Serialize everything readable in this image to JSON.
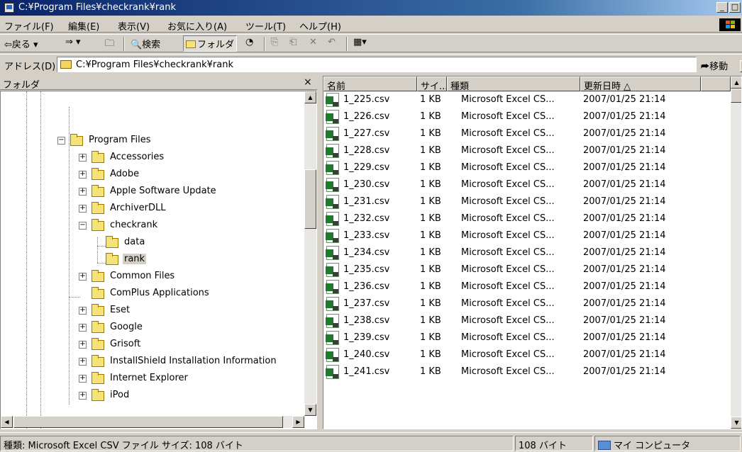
{
  "window": {
    "title": "C:¥Program Files¥checkrank¥rank"
  },
  "menu": [
    "ファイル(F)",
    "編集(E)",
    "表示(V)",
    "お気に入り(A)",
    "ツール(T)",
    "ヘルプ(H)"
  ],
  "toolbar": {
    "back": "⇦戻る ▾",
    "forward": "⇒ ▾",
    "search": "🔍検索",
    "folders": "フォルダ"
  },
  "address": {
    "label": "アドレス(D)",
    "value": "C:¥Program Files¥checkrank¥rank",
    "go": "移動"
  },
  "folder_pane": {
    "header": "フォルダ",
    "close": "×",
    "items": [
      "Program Files",
      "Accessories",
      "Adobe",
      "Apple Software Update",
      "ArchiverDLL",
      "checkrank",
      "data",
      "rank",
      "Common Files",
      "ComPlus Applications",
      "Eset",
      "Google",
      "Grisoft",
      "InstallShield Installation Information",
      "Internet Explorer",
      "iPod"
    ]
  },
  "list": {
    "columns": [
      "名前",
      "サイ...",
      "種類",
      "更新日時 △"
    ],
    "rows": [
      [
        "1_225.csv",
        "1 KB",
        "Microsoft Excel CS...",
        "2007/01/25 21:14"
      ],
      [
        "1_226.csv",
        "1 KB",
        "Microsoft Excel CS...",
        "2007/01/25 21:14"
      ],
      [
        "1_227.csv",
        "1 KB",
        "Microsoft Excel CS...",
        "2007/01/25 21:14"
      ],
      [
        "1_228.csv",
        "1 KB",
        "Microsoft Excel CS...",
        "2007/01/25 21:14"
      ],
      [
        "1_229.csv",
        "1 KB",
        "Microsoft Excel CS...",
        "2007/01/25 21:14"
      ],
      [
        "1_230.csv",
        "1 KB",
        "Microsoft Excel CS...",
        "2007/01/25 21:14"
      ],
      [
        "1_231.csv",
        "1 KB",
        "Microsoft Excel CS...",
        "2007/01/25 21:14"
      ],
      [
        "1_232.csv",
        "1 KB",
        "Microsoft Excel CS...",
        "2007/01/25 21:14"
      ],
      [
        "1_233.csv",
        "1 KB",
        "Microsoft Excel CS...",
        "2007/01/25 21:14"
      ],
      [
        "1_234.csv",
        "1 KB",
        "Microsoft Excel CS...",
        "2007/01/25 21:14"
      ],
      [
        "1_235.csv",
        "1 KB",
        "Microsoft Excel CS...",
        "2007/01/25 21:14"
      ],
      [
        "1_236.csv",
        "1 KB",
        "Microsoft Excel CS...",
        "2007/01/25 21:14"
      ],
      [
        "1_237.csv",
        "1 KB",
        "Microsoft Excel CS...",
        "2007/01/25 21:14"
      ],
      [
        "1_238.csv",
        "1 KB",
        "Microsoft Excel CS...",
        "2007/01/25 21:14"
      ],
      [
        "1_239.csv",
        "1 KB",
        "Microsoft Excel CS...",
        "2007/01/25 21:14"
      ],
      [
        "1_240.csv",
        "1 KB",
        "Microsoft Excel CS...",
        "2007/01/25 21:14"
      ],
      [
        "1_241.csv",
        "1 KB",
        "Microsoft Excel CS...",
        "2007/01/25 21:14"
      ]
    ]
  },
  "status": {
    "info": "種類: Microsoft Excel CSV ファイル サイズ: 108 バイト",
    "size": "108 バイト",
    "location": "マイ コンピュータ"
  }
}
